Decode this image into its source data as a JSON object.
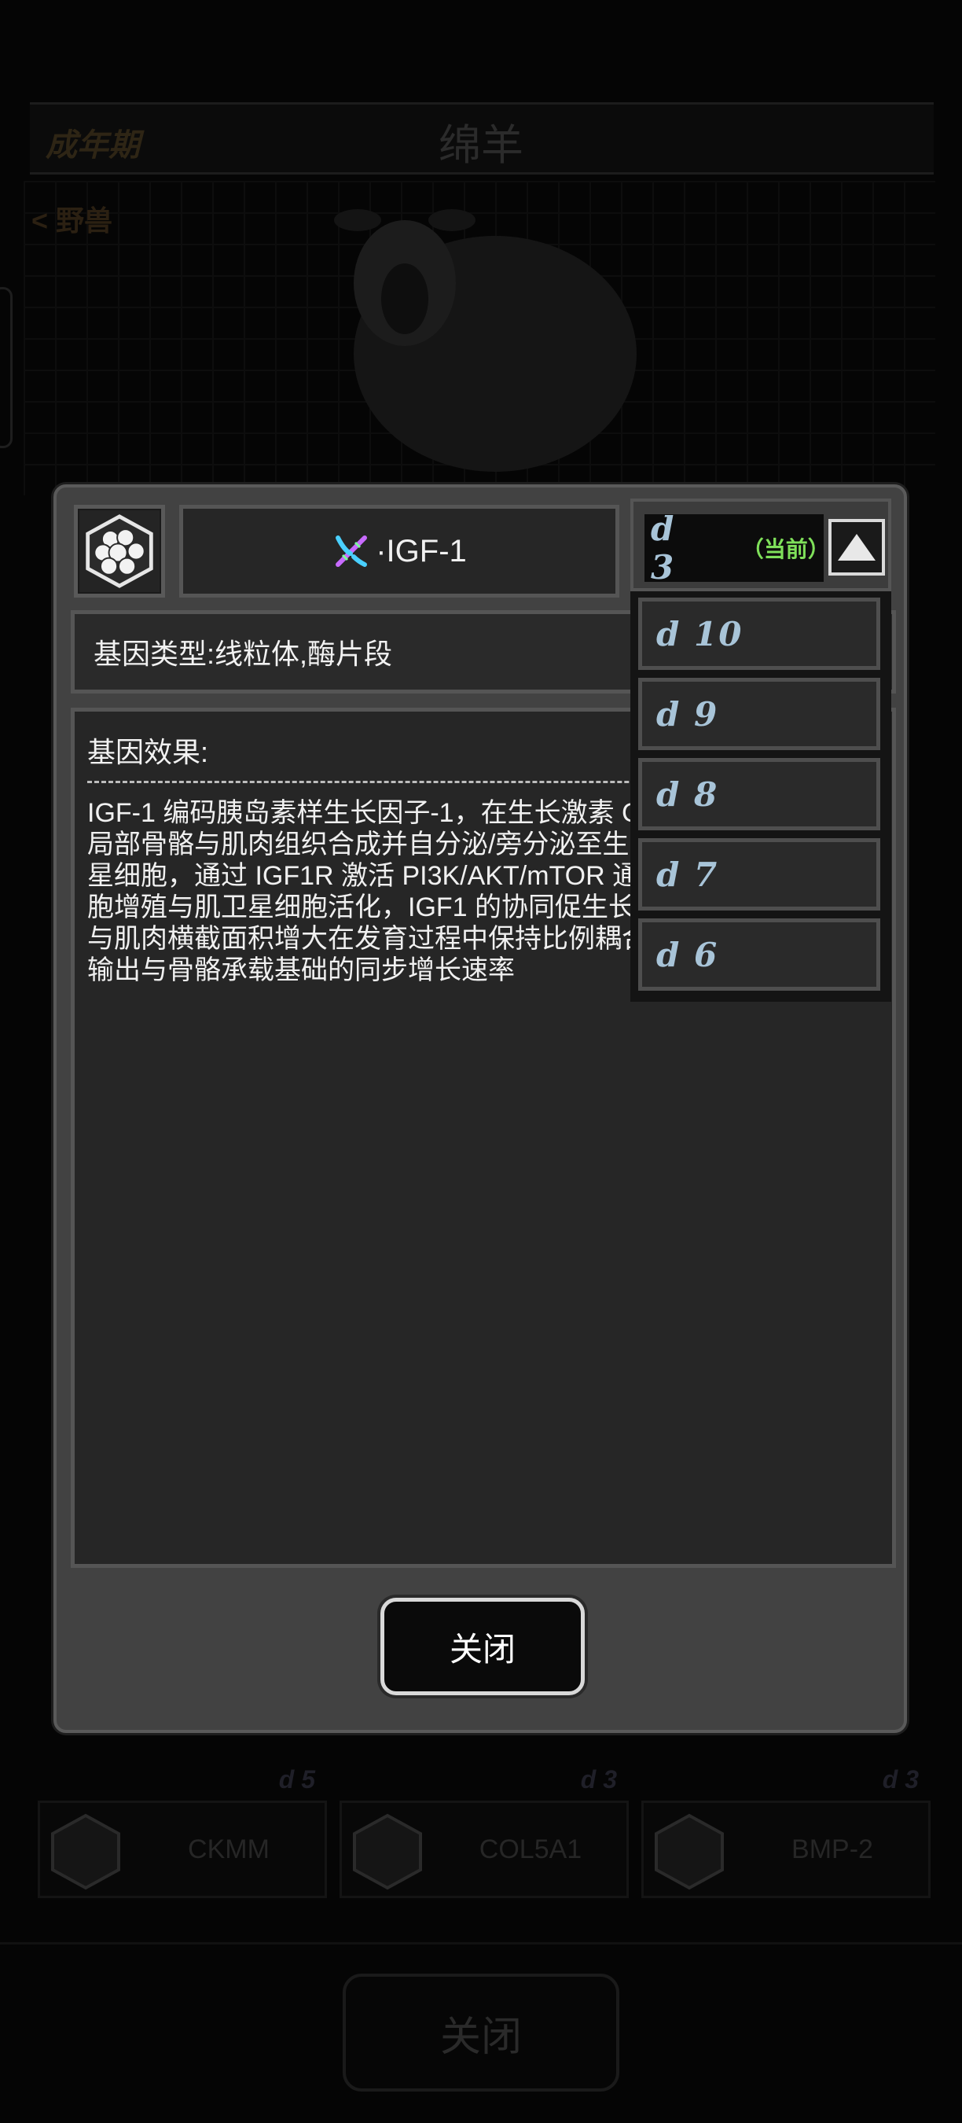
{
  "background": {
    "stage": "成年期",
    "title": "绵羊",
    "tag": "野兽",
    "cards": [
      {
        "name": "CKMM",
        "level": "d 5"
      },
      {
        "name": "COL5A1",
        "level": "d 3"
      },
      {
        "name": "BMP-2",
        "level": "d 3"
      }
    ],
    "close_label": "关闭"
  },
  "dialog": {
    "gene_name": "·IGF-1",
    "gene_type": "基因类型:线粒体,酶片段",
    "effect_title": "基因效果:",
    "effect_text": "IGF-1 编码胰岛素样生长因子-1，在生长激素 G\n局部骨骼与肌肉组织合成并自分泌/旁分泌至生\n星细胞，通过 IGF1R 激活 PI3K/AKT/mTOR 通\n胞增殖与肌卫星细胞活化，IGF1 的协同促生长\n与肌肉横截面积增大在发育过程中保持比例耦合\n输出与骨骼承载基础的同步增长速率",
    "close_label": "关闭"
  },
  "level_dropdown": {
    "current": "d 3",
    "current_tag": "（当前）",
    "options": [
      "d 10",
      "d 9",
      "d 8",
      "d 7",
      "d 6"
    ]
  }
}
